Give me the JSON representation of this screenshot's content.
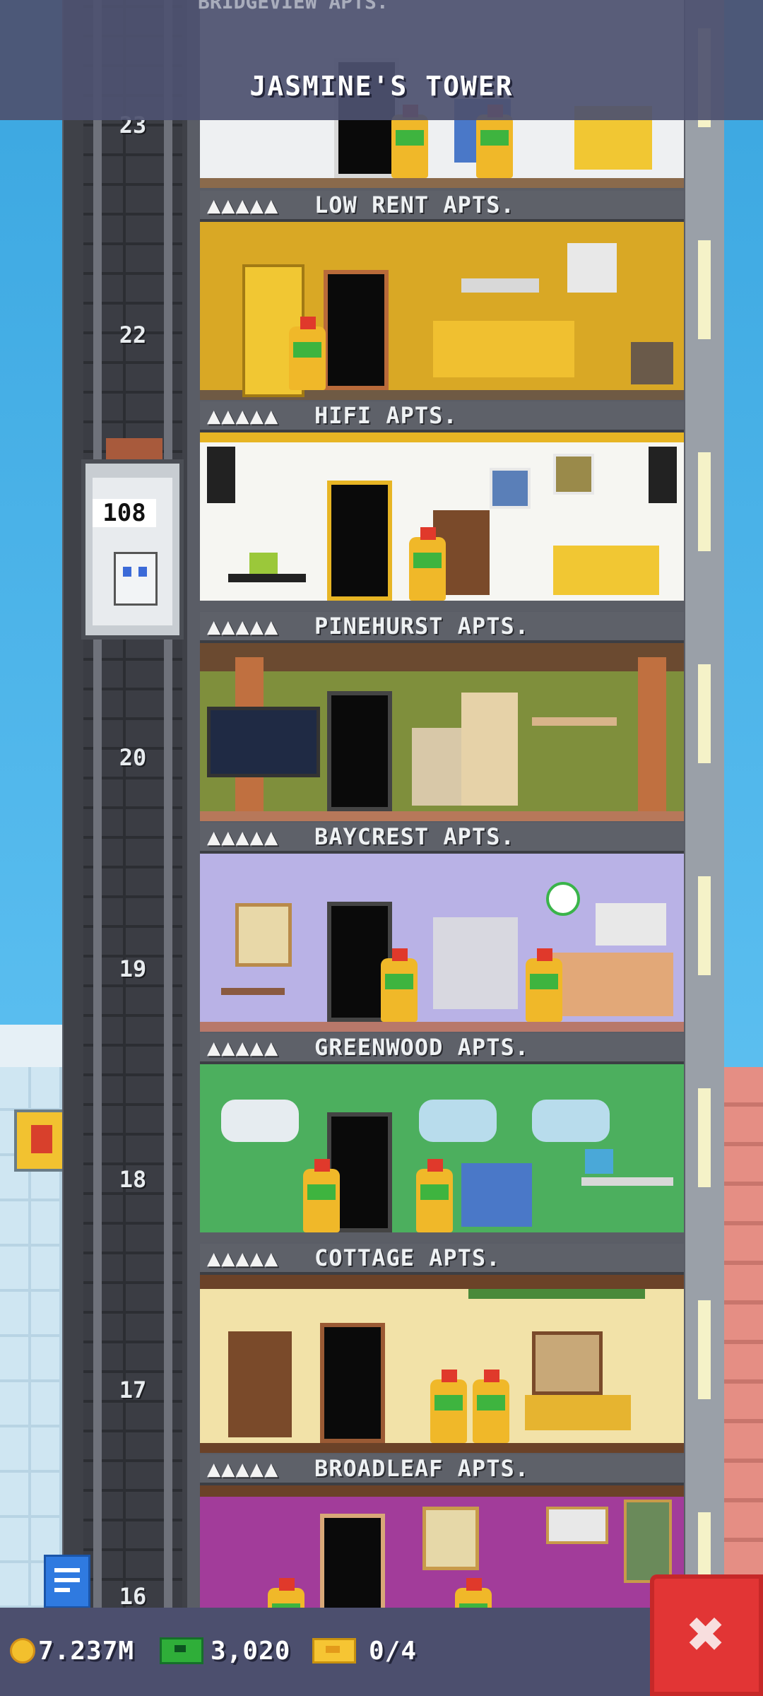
{
  "header": {
    "title": "JASMINE'S TOWER",
    "top_partial_sign": "BRIDGEVIEW APTS."
  },
  "elevator": {
    "passenger_count": "108"
  },
  "floor_numbers": {
    "f23": "23",
    "f22": "22",
    "f20": "20",
    "f19": "19",
    "f18": "18",
    "f17": "17",
    "f16": "16"
  },
  "floors": [
    {
      "name": "LOW RENT APTS.",
      "stars": "▲▲▲▲▲"
    },
    {
      "name": "HIFI APTS.",
      "stars": "▲▲▲▲▲"
    },
    {
      "name": "PINEHURST APTS.",
      "stars": "▲▲▲▲▲"
    },
    {
      "name": "BAYCREST APTS.",
      "stars": "▲▲▲▲▲"
    },
    {
      "name": "GREENWOOD APTS.",
      "stars": "▲▲▲▲▲"
    },
    {
      "name": "COTTAGE APTS.",
      "stars": "▲▲▲▲▲"
    },
    {
      "name": "BROADLEAF APTS.",
      "stars": "▲▲▲▲▲"
    }
  ],
  "status_bar": {
    "coins": "7.237M",
    "bux": "3,020",
    "tickets": "0/4"
  },
  "icons": {
    "coin": "coin-icon",
    "bux": "bux-icon",
    "ticket": "ticket-icon",
    "close": "close-icon",
    "menu": "menu-icon"
  },
  "colors": {
    "header_bg": "#4e5270",
    "close_button": "#e23535",
    "sky": "#59bdef"
  }
}
